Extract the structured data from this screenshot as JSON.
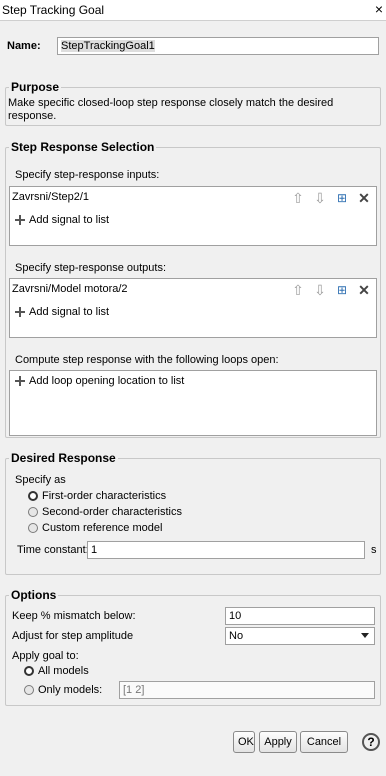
{
  "window": {
    "title": "Step Tracking Goal",
    "close": "×"
  },
  "name": {
    "label": "Name:",
    "value": "StepTrackingGoal1"
  },
  "purpose": {
    "legend": "Purpose",
    "text": "Make specific closed-loop step response closely match the desired response."
  },
  "step_response_selection": {
    "legend": "Step Response Selection",
    "inputs_label": "Specify step-response inputs:",
    "inputs_items": [
      "Zavrsni/Step2/1"
    ],
    "outputs_label": "Specify step-response outputs:",
    "outputs_items": [
      "Zavrsni/Model motora/2"
    ],
    "loops_label": "Compute step response with the following loops open:",
    "add_signal": "Add signal to list",
    "add_loop": "Add loop opening location to list"
  },
  "desired_response": {
    "legend": "Desired Response",
    "specify_as": "Specify as",
    "options": [
      "First-order characteristics",
      "Second-order characteristics",
      "Custom reference model"
    ],
    "selected_index": 0,
    "time_constant_label": "Time constant:",
    "time_constant_value": "1",
    "time_unit": "s"
  },
  "options": {
    "legend": "Options",
    "mismatch_label": "Keep % mismatch below:",
    "mismatch_value": "10",
    "adjust_label": "Adjust for step amplitude",
    "adjust_value": "No",
    "apply_label": "Apply goal to:",
    "apply_options": [
      "All models",
      "Only models:"
    ],
    "apply_selected_index": 0,
    "only_models_value": "[1 2]"
  },
  "buttons": {
    "ok": "OK",
    "apply": "Apply",
    "cancel": "Cancel",
    "help": "?"
  },
  "icons": [
    "arrow-up-icon",
    "arrow-down-icon",
    "select-signal-icon",
    "delete-icon",
    "plus-icon",
    "help-icon"
  ]
}
